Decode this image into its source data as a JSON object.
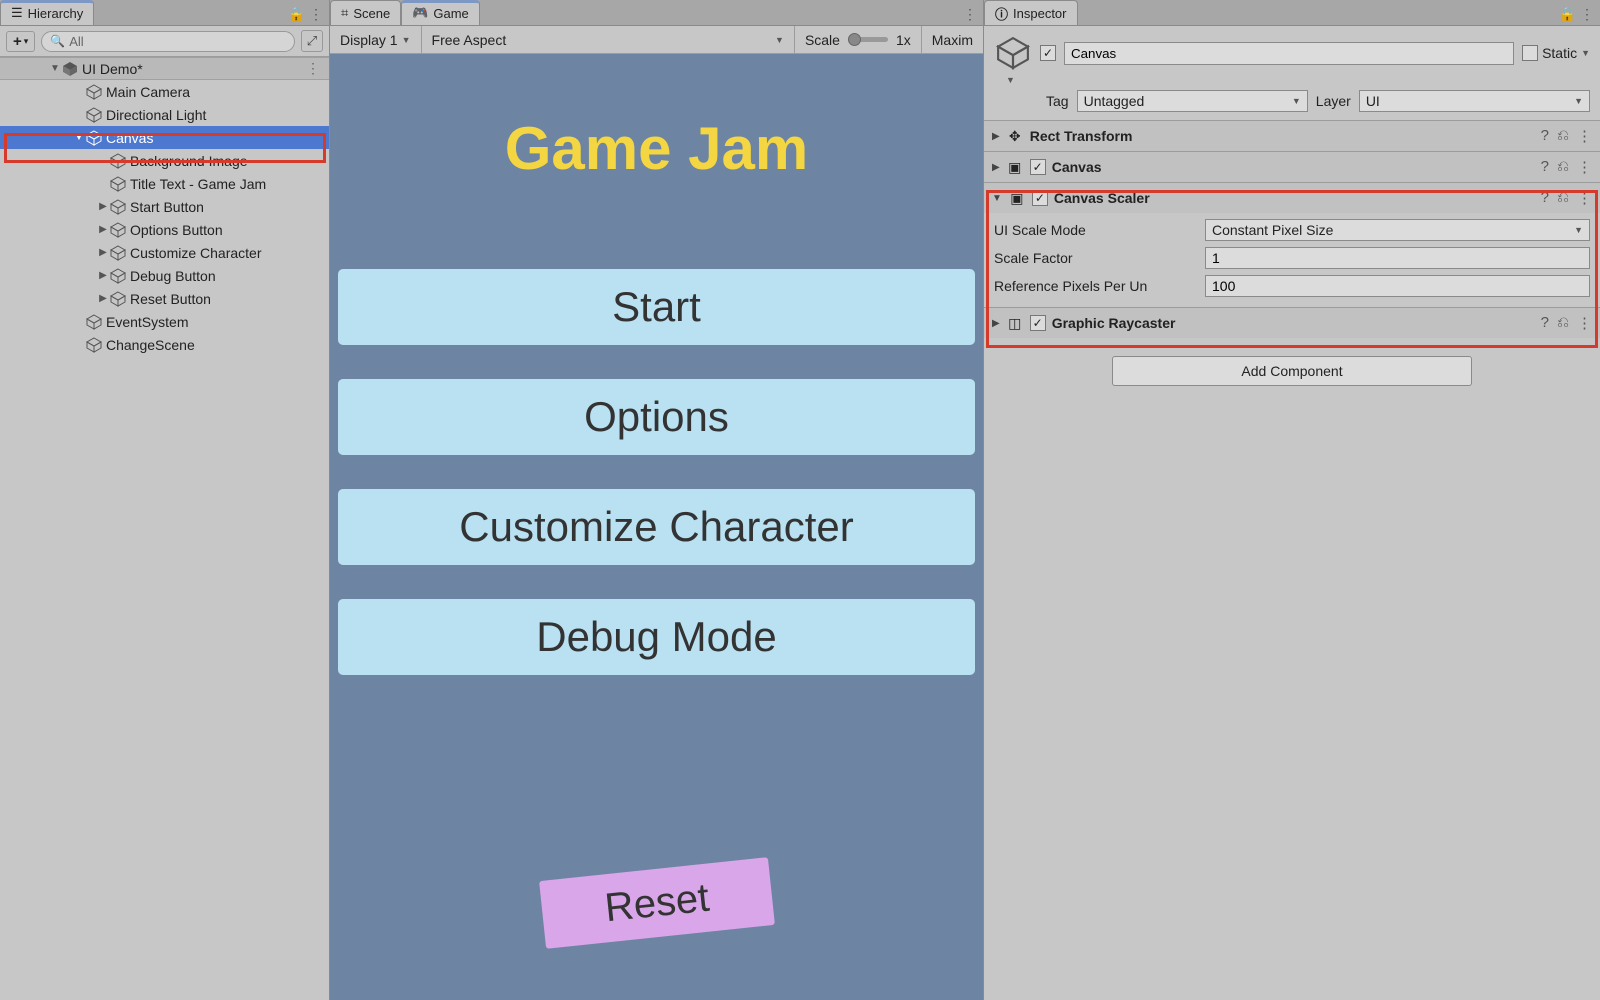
{
  "hierarchy": {
    "tab_title": "Hierarchy",
    "search_placeholder": "All",
    "scene": "UI Demo*",
    "items": [
      "Main Camera",
      "Directional Light",
      "Canvas",
      "Background Image -",
      "Title Text - Game Jam",
      "Start Button",
      "Options Button",
      "Customize Character",
      "Debug Button",
      "Reset Button",
      "EventSystem",
      "ChangeScene"
    ]
  },
  "center": {
    "tabs": {
      "scene": "Scene",
      "game": "Game"
    },
    "display": "Display 1",
    "aspect": "Free Aspect",
    "scale_label": "Scale",
    "scale_value": "1x",
    "maximize": "Maxim",
    "game": {
      "title": "Game Jam",
      "buttons": [
        "Start",
        "Options",
        "Customize Character",
        "Debug Mode"
      ],
      "reset": "Reset"
    }
  },
  "inspector": {
    "tab_title": "Inspector",
    "name": "Canvas",
    "static_label": "Static",
    "tag_label": "Tag",
    "tag_value": "Untagged",
    "layer_label": "Layer",
    "layer_value": "UI",
    "components": {
      "rect": "Rect Transform",
      "canvas": "Canvas",
      "scaler": {
        "title": "Canvas Scaler",
        "mode_label": "UI Scale Mode",
        "mode_value": "Constant Pixel Size",
        "scale_label": "Scale Factor",
        "scale_value": "1",
        "ref_label": "Reference Pixels Per Un",
        "ref_value": "100"
      },
      "raycaster": "Graphic Raycaster"
    },
    "add_component": "Add Component"
  }
}
